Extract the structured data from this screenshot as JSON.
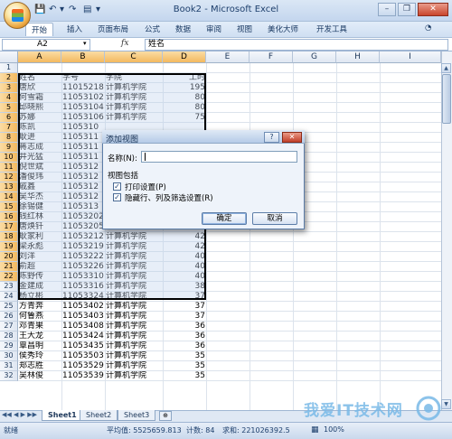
{
  "window": {
    "title": "Book2 - Microsoft Excel",
    "minimize_glyph": "–",
    "restore_glyph": "❐",
    "close_glyph": "✕"
  },
  "ribbon": {
    "tabs": [
      "开始",
      "插入",
      "页面布局",
      "公式",
      "数据",
      "审阅",
      "视图",
      "美化大师",
      "开发工具"
    ]
  },
  "formula_bar": {
    "name_box": "A2",
    "fx": "fx",
    "content": "姓名"
  },
  "columns": [
    "A",
    "B",
    "C",
    "D",
    "E",
    "F",
    "G",
    "H",
    "I"
  ],
  "rows": [
    {
      "n": "1",
      "a": "",
      "b": "",
      "c": "",
      "d": ""
    },
    {
      "n": "2",
      "a": "姓名",
      "b": "学号",
      "c": "学院",
      "d": "工时"
    },
    {
      "n": "3",
      "a": "唐欣",
      "b": "11015218",
      "c": "计算机学院",
      "d": "195"
    },
    {
      "n": "4",
      "a": "何雪霜",
      "b": "11053102",
      "c": "计算机学院",
      "d": "80"
    },
    {
      "n": "5",
      "a": "邱晓熙",
      "b": "11053104",
      "c": "计算机学院",
      "d": "80"
    },
    {
      "n": "6",
      "a": "苏娜",
      "b": "11053106",
      "c": "计算机学院",
      "d": "75"
    },
    {
      "n": "7",
      "a": "陈凯",
      "b": "1105310",
      "c": "",
      "d": ""
    },
    {
      "n": "8",
      "a": "耿进",
      "b": "1105311",
      "c": "",
      "d": ""
    },
    {
      "n": "9",
      "a": "蒋志成",
      "b": "1105311",
      "c": "",
      "d": ""
    },
    {
      "n": "10",
      "a": "井光猛",
      "b": "1105311",
      "c": "",
      "d": ""
    },
    {
      "n": "11",
      "a": "  倪世斌",
      "b": "1105312",
      "c": "",
      "d": ""
    },
    {
      "n": "12",
      "a": "潘俊玮",
      "b": "1105312",
      "c": "",
      "d": ""
    },
    {
      "n": "13",
      "a": "戚鑫",
      "b": "1105312",
      "c": "",
      "d": ""
    },
    {
      "n": "14",
      "a": "吴华杰",
      "b": "1105312",
      "c": "",
      "d": ""
    },
    {
      "n": "15",
      "a": "徐锡健",
      "b": "1105313",
      "c": "",
      "d": ""
    },
    {
      "n": "16",
      "a": "钱红林",
      "b": "11053202",
      "c": "计算机学院",
      "d": "45"
    },
    {
      "n": "17",
      "a": "唐焕钎",
      "b": "11053205",
      "c": "计算机学院",
      "d": "45"
    },
    {
      "n": "18",
      "a": "耿家利",
      "b": "11053212",
      "c": "计算机学院",
      "d": "42"
    },
    {
      "n": "19",
      "a": "梁永彪",
      "b": "11053219",
      "c": "计算机学院",
      "d": "42"
    },
    {
      "n": "20",
      "a": "刘洋",
      "b": "11053222",
      "c": "计算机学院",
      "d": "40"
    },
    {
      "n": "21",
      "a": "俞超",
      "b": "11053226",
      "c": "计算机学院",
      "d": "40"
    },
    {
      "n": "22",
      "a": "陈野传",
      "b": "11053310",
      "c": "计算机学院",
      "d": "40"
    },
    {
      "n": "23",
      "a": "金建成",
      "b": "11053316",
      "c": "计算机学院",
      "d": "38"
    },
    {
      "n": "24",
      "a": "杨立彬",
      "b": "11053324",
      "c": "计算机学院",
      "d": "37"
    },
    {
      "n": "25",
      "a": "方青奔",
      "b": "11053402",
      "c": "计算机学院",
      "d": "37"
    },
    {
      "n": "26",
      "a": "何鲁燕",
      "b": "11053403",
      "c": "计算机学院",
      "d": "37"
    },
    {
      "n": "27",
      "a": "邓青果",
      "b": "11053408",
      "c": "计算机学院",
      "d": "36"
    },
    {
      "n": "28",
      "a": "王大龙",
      "b": "11053424",
      "c": "计算机学院",
      "d": "36"
    },
    {
      "n": "29",
      "a": "覃昌明",
      "b": "11053435",
      "c": "计算机学院",
      "d": "36"
    },
    {
      "n": "30",
      "a": "侯秀玲",
      "b": "11053503",
      "c": "计算机学院",
      "d": "35"
    },
    {
      "n": "31",
      "a": "郑志胜",
      "b": "11053529",
      "c": "计算机学院",
      "d": "35"
    },
    {
      "n": "32",
      "a": "吴林俊",
      "b": "11053539",
      "c": "计算机学院",
      "d": "35"
    }
  ],
  "sheets": [
    "Sheet1",
    "Sheet2",
    "Sheet3"
  ],
  "status": {
    "ready": "就绪",
    "average": "平均值: 5525659.813",
    "count": "计数: 84",
    "sum": "求和: 221026392.5",
    "zoom": "100%"
  },
  "dialog": {
    "title": "添加视图",
    "help": "?",
    "close": "✕",
    "name_label": "名称(N):",
    "name_value": "",
    "group_label": "视图包括",
    "opt_print": "打印设置(P)",
    "opt_hidden": "隐藏行、列及筛选设置(R)",
    "check_glyph": "✓",
    "ok": "确定",
    "cancel": "取消"
  },
  "watermark": {
    "text": "我爱IT技术网"
  }
}
